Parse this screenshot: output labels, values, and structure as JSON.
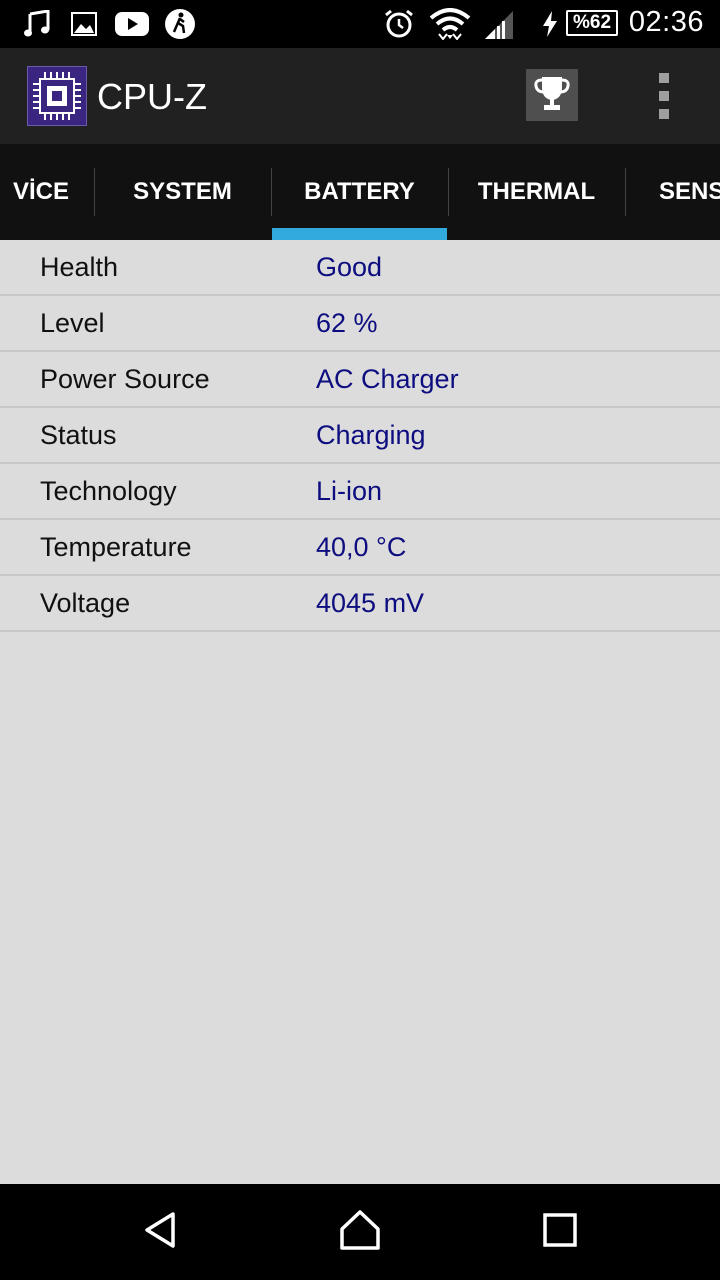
{
  "status_bar": {
    "icons": [
      "music-note-icon",
      "image-icon",
      "youtube-icon",
      "walking-icon",
      "alarm-icon",
      "wifi-icon",
      "signal-icon",
      "charging-bolt-icon"
    ],
    "battery_text": "%62",
    "time": "02:36"
  },
  "app_bar": {
    "title": "CPU-Z",
    "logo_icon": "cpu-chip-icon",
    "trophy_icon": "trophy-icon",
    "overflow_icon": "more-vert-icon"
  },
  "tabs": [
    {
      "label": "VİCE"
    },
    {
      "label": "SYSTEM"
    },
    {
      "label": "BATTERY"
    },
    {
      "label": "THERMAL"
    },
    {
      "label": "SENS"
    }
  ],
  "active_tab": "BATTERY",
  "battery": {
    "rows": [
      {
        "label": "Health",
        "value": "Good"
      },
      {
        "label": "Level",
        "value": "62 %"
      },
      {
        "label": "Power Source",
        "value": "AC Charger"
      },
      {
        "label": "Status",
        "value": "Charging"
      },
      {
        "label": "Technology",
        "value": "Li-ion"
      },
      {
        "label": "Temperature",
        "value": "40,0 °C"
      },
      {
        "label": "Voltage",
        "value": "4045 mV"
      }
    ]
  },
  "nav_bar": {
    "icons": [
      "back-icon",
      "home-icon",
      "recents-icon"
    ]
  },
  "colors": {
    "accent": "#33aadd",
    "value_text": "#0d0d80",
    "background": "#dcdcdc"
  }
}
